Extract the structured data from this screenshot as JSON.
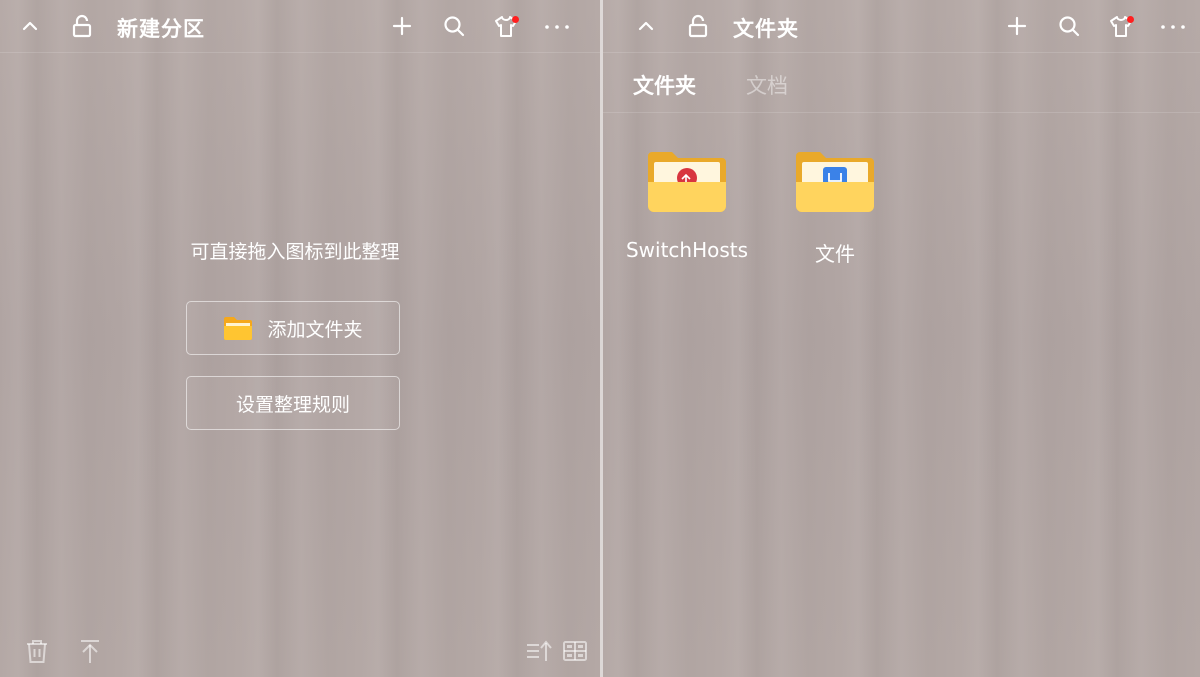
{
  "left_panel": {
    "title": "新建分区",
    "hint": "可直接拖入图标到此整理",
    "add_folder_label": "添加文件夹",
    "rules_label": "设置整理规则",
    "header_icons": [
      "collapse-icon",
      "unlock-icon",
      "add-icon",
      "search-icon",
      "skin-icon",
      "more-icon"
    ],
    "footer_icons": [
      "trash-icon",
      "pin-top-icon",
      "sort-icon",
      "grid-view-icon"
    ]
  },
  "right_panel": {
    "title": "文件夹",
    "tabs": [
      {
        "label": "文件夹",
        "active": true
      },
      {
        "label": "文档",
        "active": false
      }
    ],
    "items": [
      {
        "label": "SwitchHosts",
        "icon": "switchhosts-folder-icon"
      },
      {
        "label": "文件",
        "icon": "files-folder-icon"
      }
    ]
  },
  "colors": {
    "background": "#b3a7a4",
    "text": "#ffffff",
    "notification_dot": "#ff1f1f",
    "folder_yellow": "#f7c948",
    "switchhosts_badge": "#d8353f",
    "files_badge": "#3b82e8"
  }
}
